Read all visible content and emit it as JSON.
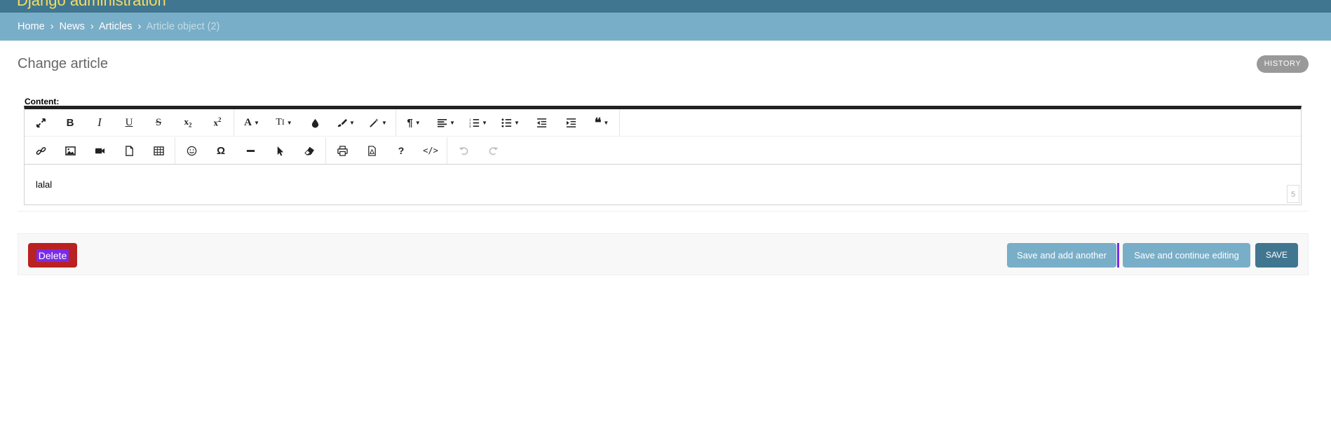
{
  "header": {
    "branding": "Django administration"
  },
  "breadcrumbs": {
    "home": "Home",
    "app": "News",
    "model": "Articles",
    "current": "Article object (2)",
    "separator": "›"
  },
  "page": {
    "title": "Change article",
    "history_label": "HISTORY"
  },
  "form": {
    "content_label": "Content:",
    "content_value": "lalal",
    "word_count": "5"
  },
  "toolbar": {
    "row1": [
      {
        "name": "fullscreen-icon",
        "glyph": "⤢"
      },
      {
        "name": "bold-icon",
        "glyph": "B"
      },
      {
        "name": "italic-icon",
        "glyph": "I"
      },
      {
        "name": "underline-icon",
        "glyph": "U"
      },
      {
        "name": "strikethrough-icon",
        "glyph": "S"
      },
      {
        "name": "subscript-icon",
        "glyph": "x₂"
      },
      {
        "name": "superscript-icon",
        "glyph": "x²"
      },
      {
        "name": "font-family-icon",
        "glyph": "A"
      },
      {
        "name": "font-size-icon",
        "glyph": "TI"
      },
      {
        "name": "color-icon",
        "glyph": "💧"
      },
      {
        "name": "paint-brush-icon",
        "glyph": "🖌"
      },
      {
        "name": "magic-icon",
        "glyph": "✎"
      },
      {
        "name": "paragraph-icon",
        "glyph": "¶"
      },
      {
        "name": "align-icon",
        "glyph": "≡"
      },
      {
        "name": "ordered-list-icon",
        "glyph": "☰"
      },
      {
        "name": "unordered-list-icon",
        "glyph": "☰"
      },
      {
        "name": "outdent-icon",
        "glyph": "⇤"
      },
      {
        "name": "indent-icon",
        "glyph": "⇥"
      },
      {
        "name": "quote-icon",
        "glyph": "❝"
      }
    ],
    "row2": [
      {
        "name": "link-icon",
        "glyph": "🔗"
      },
      {
        "name": "image-icon",
        "glyph": "🖼"
      },
      {
        "name": "video-icon",
        "glyph": "▶"
      },
      {
        "name": "file-icon",
        "glyph": "🗋"
      },
      {
        "name": "table-icon",
        "glyph": "▦"
      },
      {
        "name": "emoticon-icon",
        "glyph": "☺"
      },
      {
        "name": "special-char-icon",
        "glyph": "Ω"
      },
      {
        "name": "horizontal-line-icon",
        "glyph": "━"
      },
      {
        "name": "select-all-icon",
        "glyph": "➤"
      },
      {
        "name": "clear-format-icon",
        "glyph": "⌫"
      },
      {
        "name": "print-icon",
        "glyph": "⎙"
      },
      {
        "name": "pdf-icon",
        "glyph": "🗎"
      },
      {
        "name": "help-icon",
        "glyph": "?"
      },
      {
        "name": "code-view-icon",
        "glyph": "</>"
      },
      {
        "name": "undo-icon",
        "glyph": "↶"
      },
      {
        "name": "redo-icon",
        "glyph": "↷"
      }
    ]
  },
  "actions": {
    "delete": "Delete",
    "save_add_another": "Save and add another",
    "save_continue": "Save and continue editing",
    "save": "SAVE"
  },
  "colors": {
    "header": "#417690",
    "breadcrumbs": "#79aec8",
    "delete": "#ba2121",
    "focus": "#7a2be8"
  }
}
